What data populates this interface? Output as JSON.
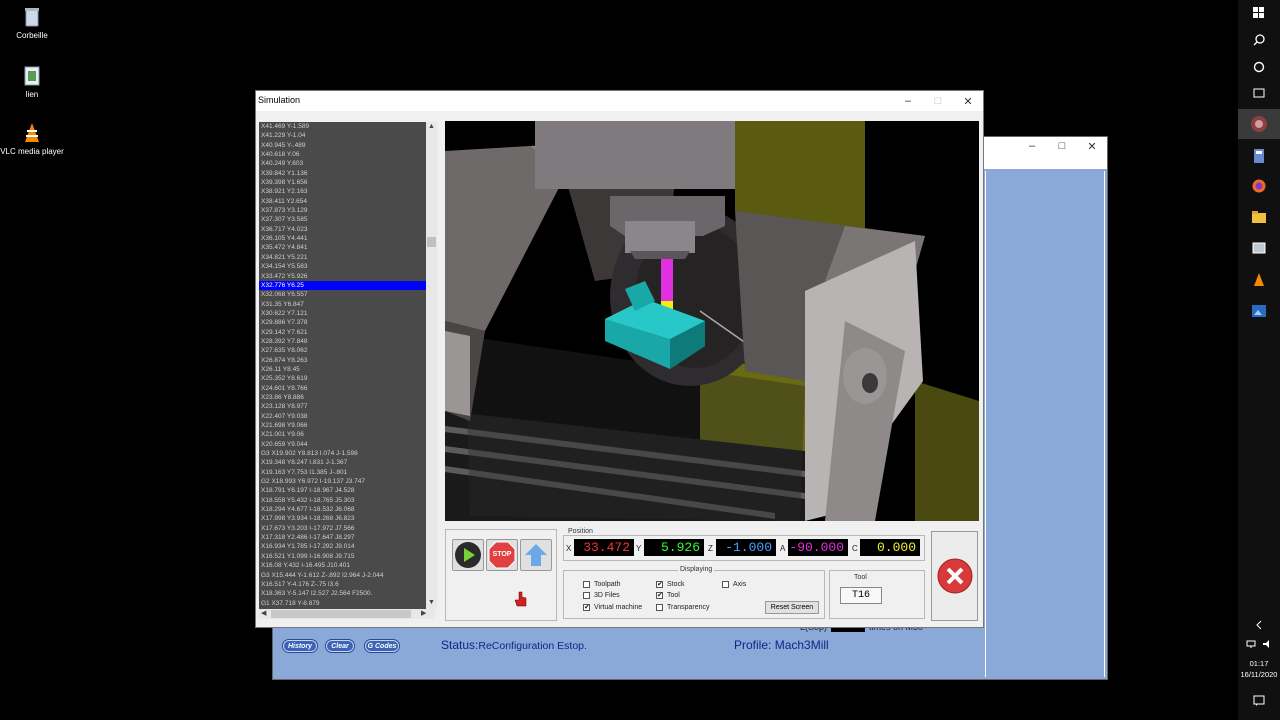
{
  "desktop": {
    "icons": [
      {
        "label": "Corbeille"
      },
      {
        "label": "lien"
      },
      {
        "label": "VLC media player"
      }
    ]
  },
  "taskbar": {
    "time": "01:17",
    "date": "16/11/2020"
  },
  "mach3": {
    "history_label": "History",
    "clear_label": "Clear",
    "gcodes_label": "G Codes",
    "status": "Status:",
    "status_value": "ReConfiguration Estop.",
    "profile": "Profile:",
    "profile_value": "Mach3Mill",
    "partial_text": "L(Sop)",
    "partial_text2": "times on M30"
  },
  "simulation": {
    "title": "Simulation",
    "gcode_lines": [
      "X41.469 Y-1.589",
      "X41.229 Y-1.04",
      "X40.945 Y-.489",
      "X40.618 Y.06",
      "X40.249 Y.603",
      "X39.842 Y1.136",
      "X39.398 Y1.656",
      "X38.921 Y2.163",
      "X38.411 Y2.654",
      "X37.873 Y3.129",
      "X37.307 Y3.585",
      "X36.717 Y4.023",
      "X36.105 Y4.441",
      "X35.472 Y4.841",
      "X34.821 Y5.221",
      "X34.154 Y5.583",
      "X33.472 Y5.926",
      "X32.776 Y6.25",
      "X32.068 Y6.557",
      "X31.35 Y6.847",
      "X30.622 Y7.121",
      "X29.886 Y7.378",
      "X29.142 Y7.621",
      "X28.392 Y7.848",
      "X27.635 Y8.062",
      "X26.874 Y8.263",
      "X26.11 Y8.45",
      "X25.352 Y8.619",
      "X24.601 Y8.766",
      "X23.86 Y8.886",
      "X23.128 Y8.977",
      "X22.407 Y9.038",
      "X21.698 Y9.066",
      "X21.001 Y9.06",
      "X20.659 Y9.044",
      "G3 X19.902 Y8.813 I.074 J-1.598",
      "X19.348 Y8.247 I.831 J-1.367",
      "X19.163 Y7.753 I1.385 J-.801",
      "G2 X18.993 Y6.972 I-19.137 J3.747",
      "X18.791 Y6.197 I-18.967 J4.528",
      "X18.558 Y5.432 I-18.765 J5.303",
      "X18.294 Y4.677 I-18.532 J6.068",
      "X17.998 Y3.934 I-18.268 J6.823",
      "X17.673 Y3.203 I-17.972 J7.566",
      "X17.318 Y2.486 I-17.647 J8.297",
      "X16.934 Y1.785 I-17.292 J9.014",
      "X16.521 Y1.099 I-16.908 J9.715",
      "X16.08 Y.432 I-16.495 J10.401",
      "G3 X15.444 Y-1.612 Z-.892 I2.964 J-2.044",
      "X16.517 Y-4.176 Z-.75 I3.6",
      "X18.363 Y-5.147 I2.527 J2.564 F2500.",
      "G1 X37.718 Y-8.879"
    ],
    "selected_index": 17,
    "position_label": "Position",
    "axes": [
      {
        "label": "X",
        "value": "33.472",
        "color": "#ff3030"
      },
      {
        "label": "Y",
        "value": "5.926",
        "color": "#30ff30"
      },
      {
        "label": "Z",
        "value": "-1.000",
        "color": "#4aa0ff"
      },
      {
        "label": "A",
        "value": "-90.000",
        "color": "#e030e0"
      },
      {
        "label": "C",
        "value": "0.000",
        "color": "#f0f030"
      }
    ],
    "displaying_label": "Displaying",
    "options": [
      {
        "label": "Toolpath",
        "checked": false
      },
      {
        "label": "3D Files",
        "checked": false
      },
      {
        "label": "Virtual machine",
        "checked": true
      },
      {
        "label": "Stock",
        "checked": true
      },
      {
        "label": "Tool",
        "checked": true
      },
      {
        "label": "Transparency",
        "checked": false
      },
      {
        "label": "Axis",
        "checked": false
      }
    ],
    "reset_screen_label": "Reset Screen",
    "tool_label": "Tool",
    "tool_value": "T16",
    "play_icon": "play-icon",
    "stop_label": "STOP",
    "rewind_icon": "rewind-icon"
  }
}
